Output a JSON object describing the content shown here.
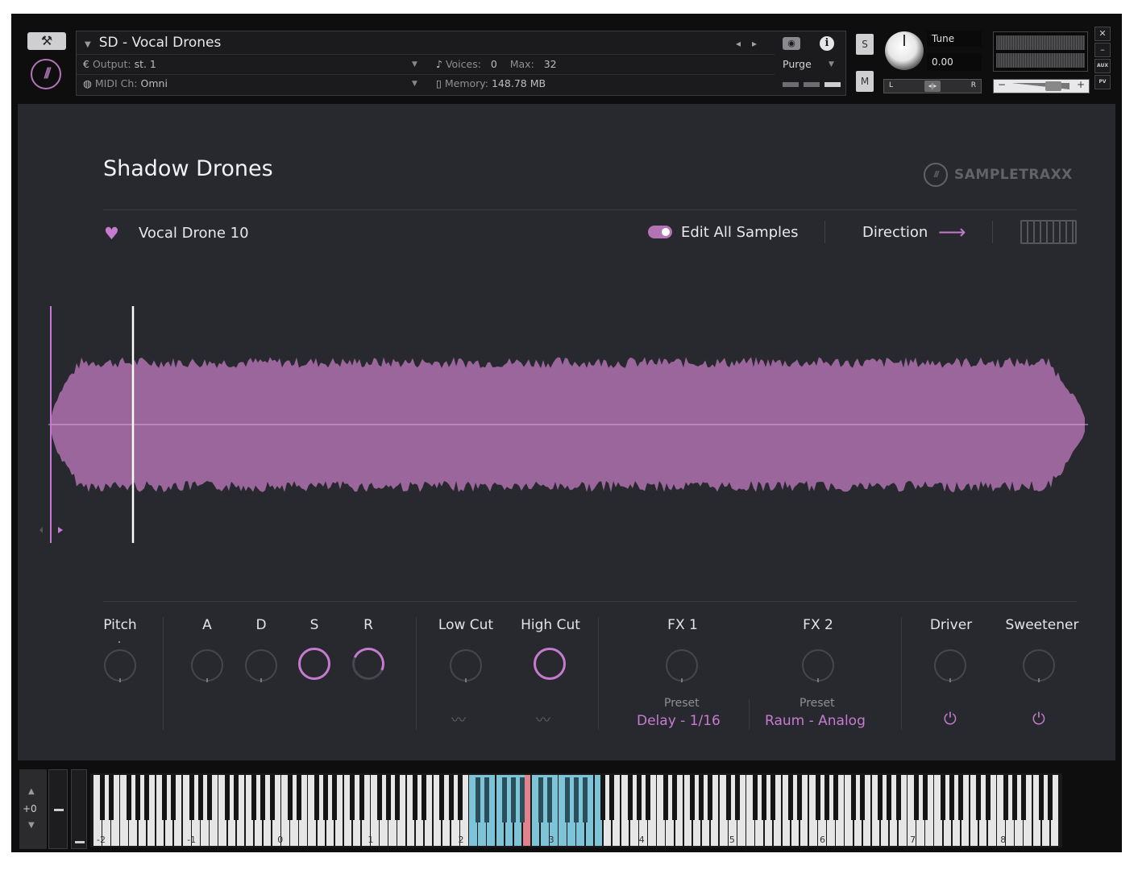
{
  "header": {
    "instrument": "SD - Vocal Drones",
    "output_label": "Output:",
    "output_value": "st. 1",
    "voices_label": "Voices:",
    "voices_value": "0",
    "max_label": "Max:",
    "max_value": "32",
    "midi_label": "MIDI Ch:",
    "midi_value": "Omni",
    "memory_label": "Memory:",
    "memory_value": "148.78 MB",
    "purge_label": "Purge",
    "solo_label": "S",
    "mute_label": "M",
    "tune_label": "Tune",
    "tune_value": "0.00",
    "pan_left": "L",
    "pan_right": "R",
    "vol_minus": "−",
    "vol_plus": "+",
    "aux_label": "AUX",
    "pv_label": "PV"
  },
  "panel": {
    "title": "Shadow Drones",
    "brand": "SAMPLETRAXX",
    "sample_name": "Vocal Drone 10",
    "edit_all_label": "Edit All Samples",
    "edit_all_on": true,
    "direction_label": "Direction",
    "waveform_color": "#b374b5"
  },
  "controls": {
    "pitch": "Pitch",
    "attack": "A",
    "decay": "D",
    "sustain": "S",
    "release": "R",
    "low_cut": "Low Cut",
    "high_cut": "High Cut",
    "fx1": "FX 1",
    "fx2": "FX 2",
    "driver": "Driver",
    "sweetener": "Sweetener",
    "fx1_preset_label": "Preset",
    "fx1_preset_value": "Delay - 1/16",
    "fx2_preset_label": "Preset",
    "fx2_preset_value": "Raum - Analog"
  },
  "keyboard": {
    "octave_shift": "+0",
    "octave_labels": [
      "-2",
      "-1",
      "0",
      "1",
      "2",
      "3",
      "4",
      "5",
      "6",
      "7",
      "8"
    ],
    "mapped_color": "#7ec4d8",
    "pressed_color": "#e0838c"
  },
  "colors": {
    "accent": "#c67bd0",
    "panel_bg": "#28292e"
  }
}
